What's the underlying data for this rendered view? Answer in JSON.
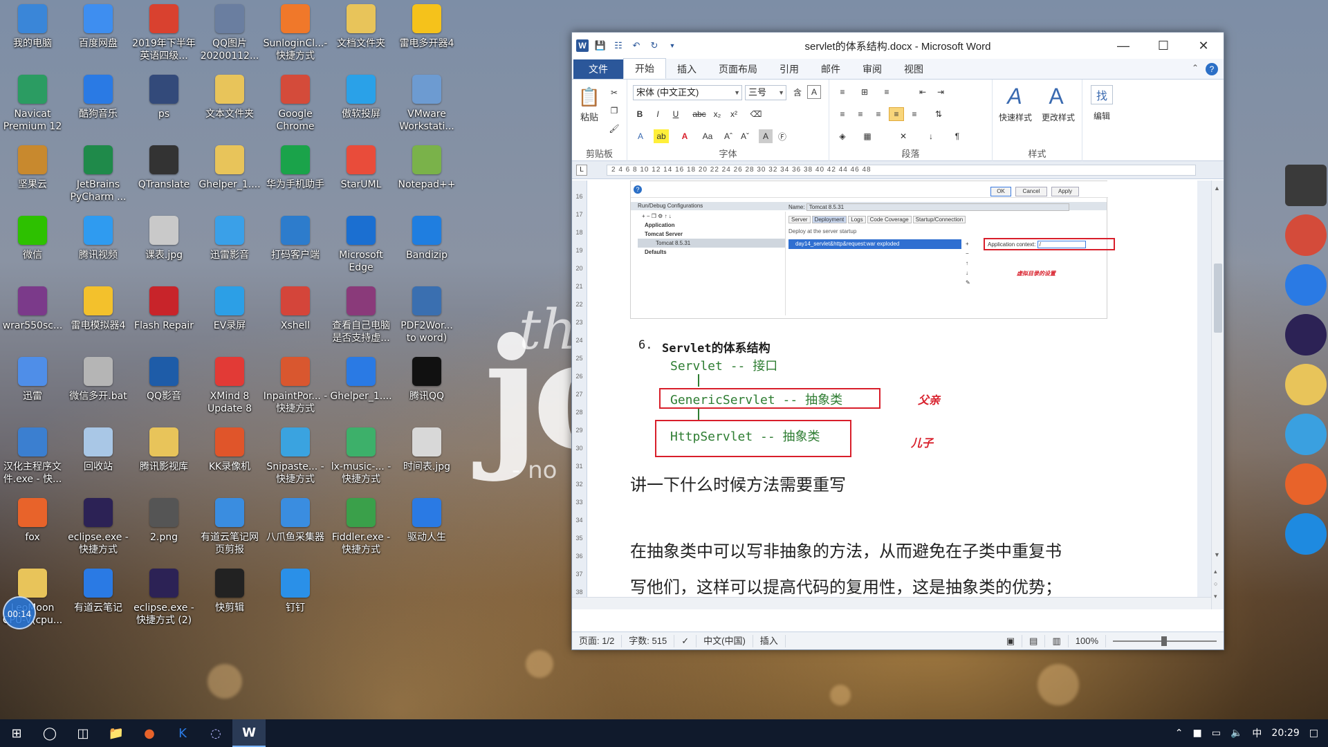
{
  "desktop": {
    "icons": [
      {
        "label": "我的电脑",
        "icon": "computer-icon",
        "color": "#3a86d8"
      },
      {
        "label": "百度网盘",
        "icon": "baidu-netdisk-icon",
        "color": "#3e8ef0"
      },
      {
        "label": "2019年下半年英语四级...",
        "icon": "pdf-icon",
        "color": "#d9412f"
      },
      {
        "label": "QQ图片20200112...",
        "icon": "image-icon",
        "color": "#6a7ea0"
      },
      {
        "label": "SunloginCl...- 快捷方式",
        "icon": "sunlogin-icon",
        "color": "#f0782a"
      },
      {
        "label": "文档文件夹",
        "icon": "folder-icon",
        "color": "#e8c45a"
      },
      {
        "label": "雷电多开器4",
        "icon": "ldmulti-icon",
        "color": "#f5c21b"
      },
      {
        "label": "Navicat Premium 12",
        "icon": "navicat-icon",
        "color": "#2b9c62"
      },
      {
        "label": "酷狗音乐",
        "icon": "kugou-icon",
        "color": "#2a7ae4"
      },
      {
        "label": "ps",
        "icon": "file-icon",
        "color": "#334a7a"
      },
      {
        "label": "文本文件夹",
        "icon": "folder-icon",
        "color": "#e8c45a"
      },
      {
        "label": "Google Chrome",
        "icon": "chrome-icon",
        "color": "#d44b3a"
      },
      {
        "label": "傲软投屏",
        "icon": "apowermirror-icon",
        "color": "#2aa1e8"
      },
      {
        "label": "VMware Workstati...",
        "icon": "vmware-icon",
        "color": "#6d9bd1"
      },
      {
        "label": "坚果云",
        "icon": "nutstore-icon",
        "color": "#c8892e"
      },
      {
        "label": "JetBrains PyCharm ...",
        "icon": "pycharm-icon",
        "color": "#1f8a4a"
      },
      {
        "label": "QTranslate",
        "icon": "qtranslate-icon",
        "color": "#333333"
      },
      {
        "label": "Ghelper_1....",
        "icon": "folder-icon",
        "color": "#e8c45a"
      },
      {
        "label": "华为手机助手",
        "icon": "huawei-hisuite-icon",
        "color": "#1aa34a"
      },
      {
        "label": "StarUML",
        "icon": "staruml-icon",
        "color": "#e94c3a"
      },
      {
        "label": "Notepad++",
        "icon": "notepadpp-icon",
        "color": "#7ab24a"
      },
      {
        "label": "微信",
        "icon": "wechat-icon",
        "color": "#2dc100"
      },
      {
        "label": "腾讯视频",
        "icon": "tencent-video-icon",
        "color": "#2f9bf0"
      },
      {
        "label": "课表.jpg",
        "icon": "image-file-icon",
        "color": "#c9c9c9"
      },
      {
        "label": "迅雷影音",
        "icon": "xunlei-player-icon",
        "color": "#3aa0e8"
      },
      {
        "label": "打码客户端",
        "icon": "app-icon",
        "color": "#2d7ccc"
      },
      {
        "label": "Microsoft Edge",
        "icon": "edge-icon",
        "color": "#1b6fd1"
      },
      {
        "label": "Bandizip",
        "icon": "bandizip-icon",
        "color": "#1f7ee0"
      },
      {
        "label": "wrar550sc...",
        "icon": "winrar-icon",
        "color": "#7b3a8a"
      },
      {
        "label": "雷电模拟器4",
        "icon": "ldplayer-icon",
        "color": "#f3c12c"
      },
      {
        "label": "Flash Repair",
        "icon": "flash-icon",
        "color": "#c8242a"
      },
      {
        "label": "EV录屏",
        "icon": "ev-recorder-icon",
        "color": "#2c9fe6"
      },
      {
        "label": "Xshell",
        "icon": "xshell-icon",
        "color": "#d4453a"
      },
      {
        "label": "查看自己电脑是否支持虚...",
        "icon": "rar-icon",
        "color": "#8a3a7a"
      },
      {
        "label": "PDF2Wor... to word)",
        "icon": "pdf2word-icon",
        "color": "#3a6fb0"
      },
      {
        "label": "迅雷",
        "icon": "xunlei-icon",
        "color": "#4f8ee8"
      },
      {
        "label": "微信多开.bat",
        "icon": "bat-file-icon",
        "color": "#b5b5b5"
      },
      {
        "label": "QQ影音",
        "icon": "qqplayer-icon",
        "color": "#1e5ca8"
      },
      {
        "label": "XMind 8 Update 8",
        "icon": "xmind-icon",
        "color": "#e23a36"
      },
      {
        "label": "InpaintPor... - 快捷方式",
        "icon": "inpaint-icon",
        "color": "#d9572f"
      },
      {
        "label": "Ghelper_1....",
        "icon": "zip-icon",
        "color": "#2a7ae4"
      },
      {
        "label": "腾讯QQ",
        "icon": "qq-icon",
        "color": "#111111"
      },
      {
        "label": "汉化主程序文件.exe - 快...",
        "icon": "exe-icon",
        "color": "#3b7fd0"
      },
      {
        "label": "回收站",
        "icon": "recycle-bin-icon",
        "color": "#a9c7e6"
      },
      {
        "label": "腾讯影视库",
        "icon": "folder-icon",
        "color": "#e8c45a"
      },
      {
        "label": "KK录像机",
        "icon": "kk-recorder-icon",
        "color": "#e0552a"
      },
      {
        "label": "Snipaste... - 快捷方式",
        "icon": "snipaste-icon",
        "color": "#3aa3e0"
      },
      {
        "label": "lx-music-... - 快捷方式",
        "icon": "lx-music-icon",
        "color": "#3db06a"
      },
      {
        "label": "时间表.jpg",
        "icon": "image-file-icon",
        "color": "#d8d8d8"
      },
      {
        "label": "fox",
        "icon": "firefox-icon",
        "color": "#e8632a"
      },
      {
        "label": "eclipse.exe - 快捷方式",
        "icon": "eclipse-icon",
        "color": "#2c2255"
      },
      {
        "label": "2.png",
        "icon": "image-file-icon",
        "color": "#555555"
      },
      {
        "label": "有道云笔记网页剪报",
        "icon": "youdao-clip-icon",
        "color": "#3a8de0"
      },
      {
        "label": "八爪鱼采集器",
        "icon": "octoparse-icon",
        "color": "#3a8de0"
      },
      {
        "label": "Fiddler.exe - 快捷方式",
        "icon": "fiddler-icon",
        "color": "#3aa04a"
      },
      {
        "label": "驱动人生",
        "icon": "driver-icon",
        "color": "#2a7ae4"
      },
      {
        "label": "LeoMoon CPU-V(cpu...",
        "icon": "leomoon-icon",
        "color": "#e8c45a"
      },
      {
        "label": "有道云笔记",
        "icon": "youdao-note-icon",
        "color": "#2a7ae4"
      },
      {
        "label": "eclipse.exe - 快捷方式 (2)",
        "icon": "eclipse-icon",
        "color": "#2c2255"
      },
      {
        "label": "快剪辑",
        "icon": "kuaijianji-icon",
        "color": "#222222"
      },
      {
        "label": "钉钉",
        "icon": "dingtalk-icon",
        "color": "#2a90e8"
      }
    ],
    "clock_bubble": "00:14",
    "dock": [
      {
        "icon": "grid-app-icon",
        "color": "#3a3a3a"
      },
      {
        "icon": "chrome-icon",
        "color": "#d44b3a"
      },
      {
        "icon": "kugou-icon",
        "color": "#2a7ae4"
      },
      {
        "icon": "eclipse-icon",
        "color": "#2c2255"
      },
      {
        "icon": "folder-icon",
        "color": "#e8c45a"
      },
      {
        "icon": "huawei-hisuite-icon",
        "color": "#3aa0e0"
      },
      {
        "icon": "firefox-icon",
        "color": "#e8632a"
      },
      {
        "icon": "ie-icon",
        "color": "#1e8ae0"
      }
    ]
  },
  "word": {
    "title": "servlet的体系结构.docx - Microsoft Word",
    "tabs": [
      "文件",
      "开始",
      "插入",
      "页面布局",
      "引用",
      "邮件",
      "审阅",
      "视图"
    ],
    "active_tab": "开始",
    "ribbon": {
      "clipboard_label": "剪贴板",
      "paste_label": "粘贴",
      "font_label": "字体",
      "font_name": "宋体 (中文正文)",
      "font_size": "三号",
      "paragraph_label": "段落",
      "styles_label": "样式",
      "quick_styles": "快速样式",
      "change_styles": "更改样式",
      "edit_label": "编辑"
    },
    "ruler_text": "2 4 6 8 10 12 14 16 18 20 22 24 26 28 30 32 34 36 38 40 42 44 46 48",
    "vruler_text": "16 17 18 19 20 21 22 23 24 25 26 27 28 29 30 31 32 33 34 35 36 37 38 39",
    "embedded_screenshot": {
      "title": "Run/Debug Configurations",
      "buttons": [
        "OK",
        "Cancel",
        "Apply"
      ],
      "name_label": "Name:",
      "name_value": "Tomcat 8.5.31",
      "tree": [
        "Application",
        "Tomcat Server",
        "Tomcat 8.5.31",
        "Defaults"
      ],
      "tabs": [
        "Server",
        "Deployment",
        "Logs",
        "Code Coverage",
        "Startup/Connection"
      ],
      "deploy_label": "Deploy at the server startup",
      "artifact": "day14_servlet&http&request:war exploded",
      "app_context_label": "Application context:",
      "app_context_value": "/",
      "annotation": "虚拟目录的设置"
    },
    "doc": {
      "item_num": "6.",
      "item_title": "Servlet的体系结构",
      "line_servlet": "Servlet -- 接口",
      "line_generic": "GenericServlet -- 抽象类",
      "line_http": "HttpServlet  -- 抽象类",
      "label_father": "父亲",
      "label_son": "儿子",
      "para1": "讲一下什么时候方法需要重写",
      "para2": "在抽象类中可以写非抽象的方法，从而避免在子类中重复书",
      "para3": "写他们，这样可以提高代码的复用性，这是抽象类的优势；"
    },
    "status": {
      "page": "页面: 1/2",
      "words": "字数: 515",
      "lang": "中文(中国)",
      "mode": "插入",
      "zoom": "100%"
    }
  },
  "taskbar": {
    "time": "20:29",
    "ime": "中"
  }
}
